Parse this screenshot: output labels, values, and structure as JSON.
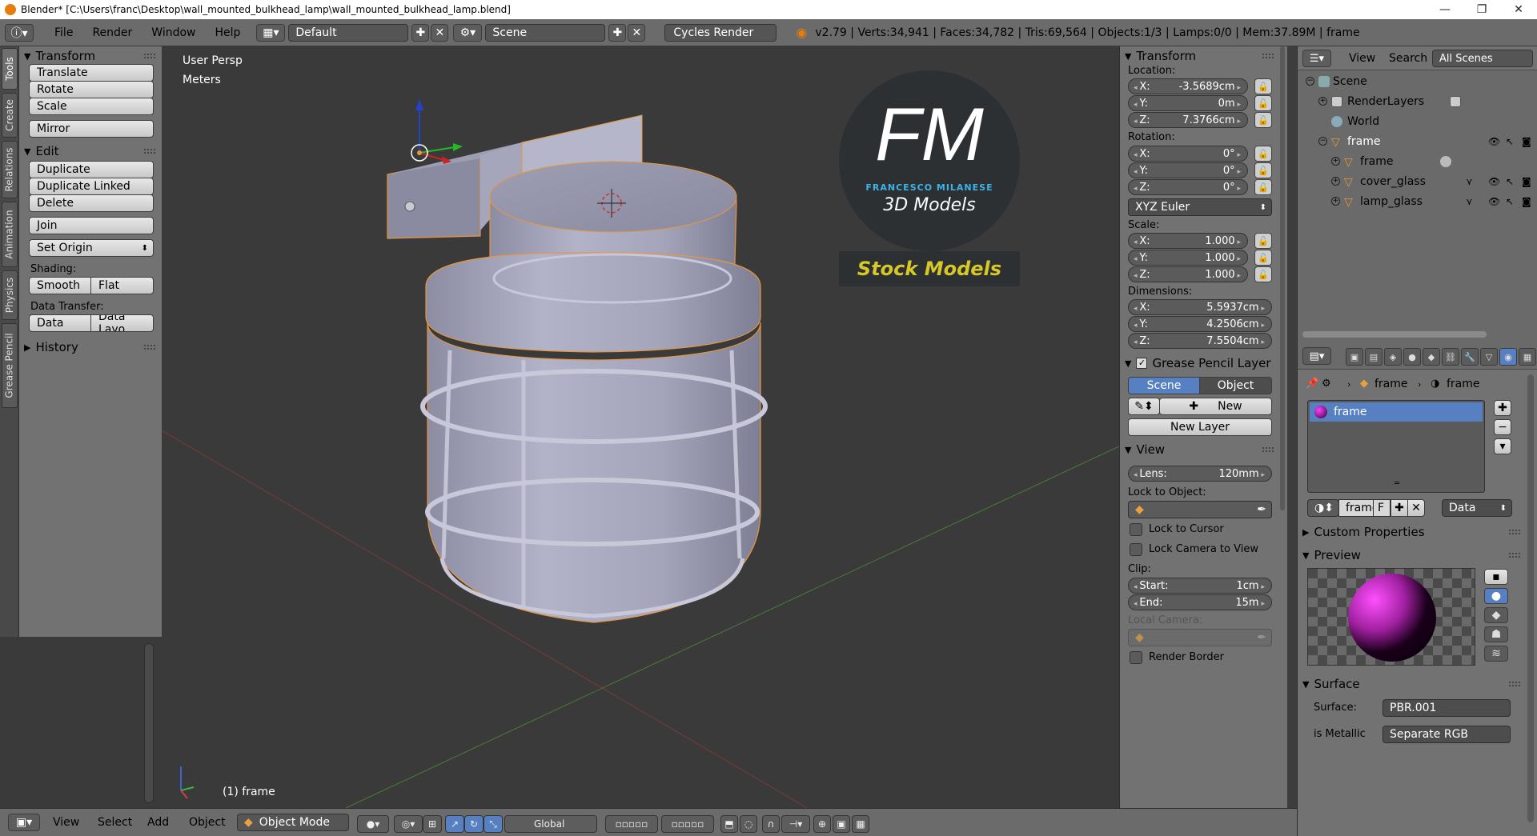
{
  "window": {
    "title": "Blender* [C:\\Users\\franc\\Desktop\\wall_mounted_bulkhead_lamp\\wall_mounted_bulkhead_lamp.blend]",
    "controls": [
      "—",
      "❐",
      "✕"
    ]
  },
  "infobar": {
    "menus": [
      "File",
      "Render",
      "Window",
      "Help"
    ],
    "layout": "Default",
    "scene": "Scene",
    "engine": "Cycles Render",
    "stats": "v2.79 | Verts:34,941 | Faces:34,782 | Tris:69,564 | Objects:1/3 | Lamps:0/0 | Mem:37.89M | frame"
  },
  "tool_tabs": [
    "Tools",
    "Create",
    "Relations",
    "Animation",
    "Physics",
    "Grease Pencil"
  ],
  "toolshelf": {
    "transform_title": "Transform",
    "translate": "Translate",
    "rotate": "Rotate",
    "scale": "Scale",
    "mirror": "Mirror",
    "edit_title": "Edit",
    "duplicate": "Duplicate",
    "duplicate_linked": "Duplicate Linked",
    "delete": "Delete",
    "join": "Join",
    "set_origin": "Set Origin",
    "shading_label": "Shading:",
    "smooth": "Smooth",
    "flat": "Flat",
    "data_transfer_label": "Data Transfer:",
    "data": "Data",
    "data_layout": "Data Layo",
    "history_title": "History"
  },
  "viewport": {
    "view_name": "User Persp",
    "units": "Meters",
    "object_label": "(1) frame",
    "logo_letters": "FM",
    "logo_name": "FRANCESCO MILANESE",
    "logo_sub": "3D Models",
    "stock_banner": "Stock Models",
    "colors": {
      "background": "#3a3a3a",
      "logo_blue": "#3db3e8",
      "stock_yellow": "#d6c826",
      "object": "#a8a8c0",
      "selection": "#e8973a"
    }
  },
  "npanel": {
    "transform_title": "Transform",
    "location_label": "Location:",
    "location": [
      {
        "axis": "X:",
        "value": "-3.5689cm"
      },
      {
        "axis": "Y:",
        "value": "0m"
      },
      {
        "axis": "Z:",
        "value": "7.3766cm"
      }
    ],
    "rotation_label": "Rotation:",
    "rotation": [
      {
        "axis": "X:",
        "value": "0°"
      },
      {
        "axis": "Y:",
        "value": "0°"
      },
      {
        "axis": "Z:",
        "value": "0°"
      }
    ],
    "rotation_mode": "XYZ Euler",
    "scale_label": "Scale:",
    "scale": [
      {
        "axis": "X:",
        "value": "1.000"
      },
      {
        "axis": "Y:",
        "value": "1.000"
      },
      {
        "axis": "Z:",
        "value": "1.000"
      }
    ],
    "dimensions_label": "Dimensions:",
    "dimensions": [
      {
        "axis": "X:",
        "value": "5.5937cm"
      },
      {
        "axis": "Y:",
        "value": "4.2506cm"
      },
      {
        "axis": "Z:",
        "value": "7.5504cm"
      }
    ],
    "grease_title": "Grease Pencil Layer",
    "grease_scene": "Scene",
    "grease_object": "Object",
    "grease_new": "New",
    "grease_new_layer": "New Layer",
    "view_title": "View",
    "lens_label": "Lens:",
    "lens_value": "120mm",
    "lock_to_object": "Lock to Object:",
    "lock_to_cursor": "Lock to Cursor",
    "lock_camera": "Lock Camera to View",
    "clip_label": "Clip:",
    "clip_start_label": "Start:",
    "clip_start": "1cm",
    "clip_end_label": "End:",
    "clip_end": "15m",
    "local_camera": "Local Camera:",
    "render_border": "Render Border"
  },
  "outliner": {
    "view": "View",
    "search": "Search",
    "all_scenes": "All Scenes",
    "items": [
      "Scene",
      "RenderLayers",
      "World",
      "frame",
      "frame",
      "cover_glass",
      "lamp_glass"
    ]
  },
  "properties": {
    "breadcrumb_object": "frame",
    "breadcrumb_material": "frame",
    "material_slot": "frame",
    "material_name": "frame",
    "material_users": "F",
    "link_mode": "Data",
    "custom_properties": "Custom Properties",
    "preview": "Preview",
    "surface_title": "Surface",
    "surface_label": "Surface:",
    "surface_value": "PBR.001",
    "metallic_label": "is Metallic",
    "metallic_value": "Separate RGB"
  },
  "viewheader": {
    "view": "View",
    "select": "Select",
    "add": "Add",
    "object": "Object",
    "mode": "Object Mode",
    "orientation": "Global"
  }
}
